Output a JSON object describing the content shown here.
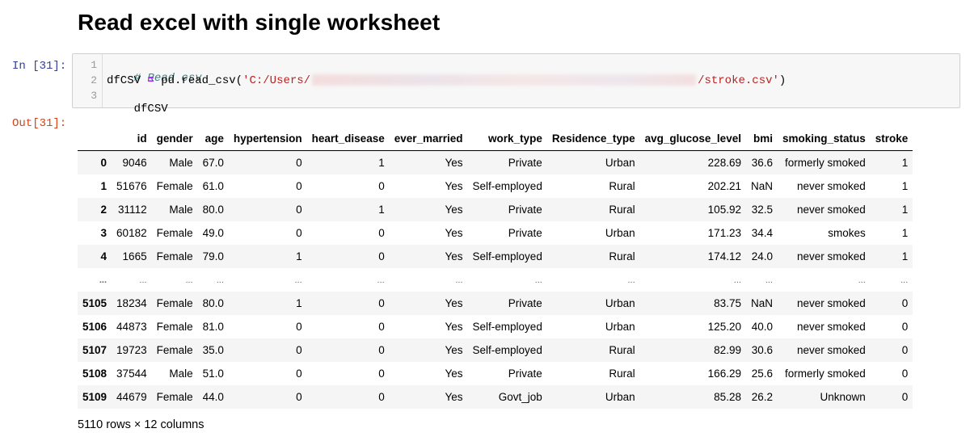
{
  "heading": "Read excel with single worksheet",
  "in_prompt": "In [31]:",
  "out_prompt": "Out[31]:",
  "code": {
    "line_numbers": [
      "1",
      "2",
      "3"
    ],
    "line1": "# Read csv",
    "line2_var": "dfCSV",
    "line2_eq": "=",
    "line2_call": "pd.read_csv(",
    "line2_str_start": "'C:/Users/",
    "line2_str_end": "/stroke.csv'",
    "line2_close": ")",
    "line3": "dfCSV"
  },
  "table": {
    "columns": [
      "",
      "id",
      "gender",
      "age",
      "hypertension",
      "heart_disease",
      "ever_married",
      "work_type",
      "Residence_type",
      "avg_glucose_level",
      "bmi",
      "smoking_status",
      "stroke"
    ],
    "rows": [
      [
        "0",
        "9046",
        "Male",
        "67.0",
        "0",
        "1",
        "Yes",
        "Private",
        "Urban",
        "228.69",
        "36.6",
        "formerly smoked",
        "1"
      ],
      [
        "1",
        "51676",
        "Female",
        "61.0",
        "0",
        "0",
        "Yes",
        "Self-employed",
        "Rural",
        "202.21",
        "NaN",
        "never smoked",
        "1"
      ],
      [
        "2",
        "31112",
        "Male",
        "80.0",
        "0",
        "1",
        "Yes",
        "Private",
        "Rural",
        "105.92",
        "32.5",
        "never smoked",
        "1"
      ],
      [
        "3",
        "60182",
        "Female",
        "49.0",
        "0",
        "0",
        "Yes",
        "Private",
        "Urban",
        "171.23",
        "34.4",
        "smokes",
        "1"
      ],
      [
        "4",
        "1665",
        "Female",
        "79.0",
        "1",
        "0",
        "Yes",
        "Self-employed",
        "Rural",
        "174.12",
        "24.0",
        "never smoked",
        "1"
      ],
      [
        "...",
        "...",
        "...",
        "...",
        "...",
        "...",
        "...",
        "...",
        "...",
        "...",
        "...",
        "...",
        "..."
      ],
      [
        "5105",
        "18234",
        "Female",
        "80.0",
        "1",
        "0",
        "Yes",
        "Private",
        "Urban",
        "83.75",
        "NaN",
        "never smoked",
        "0"
      ],
      [
        "5106",
        "44873",
        "Female",
        "81.0",
        "0",
        "0",
        "Yes",
        "Self-employed",
        "Urban",
        "125.20",
        "40.0",
        "never smoked",
        "0"
      ],
      [
        "5107",
        "19723",
        "Female",
        "35.0",
        "0",
        "0",
        "Yes",
        "Self-employed",
        "Rural",
        "82.99",
        "30.6",
        "never smoked",
        "0"
      ],
      [
        "5108",
        "37544",
        "Male",
        "51.0",
        "0",
        "0",
        "Yes",
        "Private",
        "Rural",
        "166.29",
        "25.6",
        "formerly smoked",
        "0"
      ],
      [
        "5109",
        "44679",
        "Female",
        "44.0",
        "0",
        "0",
        "Yes",
        "Govt_job",
        "Urban",
        "85.28",
        "26.2",
        "Unknown",
        "0"
      ]
    ]
  },
  "footer": "5110 rows × 12 columns"
}
